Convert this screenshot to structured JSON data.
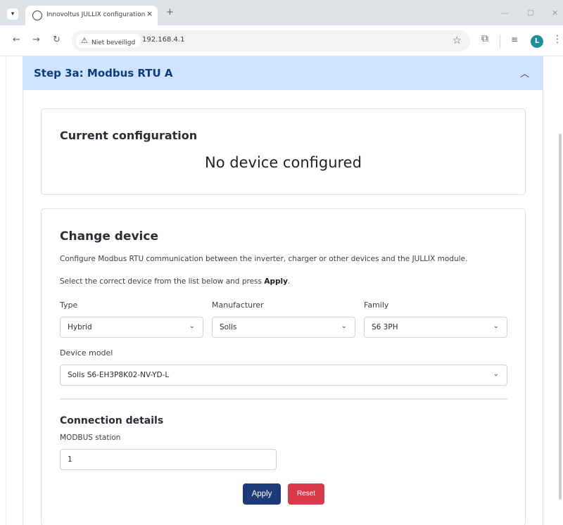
{
  "browser": {
    "tab_title": "Innovoltus JULLIX configuration",
    "tab_close": "×",
    "new_tab": "+",
    "security_label": "Niet beveiligd",
    "url": "192.168.4.1",
    "profile_initial": "L"
  },
  "icons": {
    "tab_menu": "chevron-down-icon",
    "favicon": "globe-icon",
    "back": "arrow-left-icon",
    "forward": "arrow-right-icon",
    "reload": "reload-icon",
    "warning": "warning-triangle-icon",
    "bookmark": "star-icon",
    "extensions": "puzzle-icon",
    "side_panel": "side-panel-icon",
    "menu": "kebab-menu-icon",
    "accordion": "chevron-up-icon",
    "select": "chevron-down-icon"
  },
  "accordion": {
    "title": "Step 3a: Modbus RTU A"
  },
  "current_config": {
    "heading": "Current configuration",
    "status": "No device configured"
  },
  "change_device": {
    "heading": "Change device",
    "description": "Configure Modbus RTU communication between the inverter, charger or other devices and the JULLIX module.",
    "instruction_prefix": "Select the correct device from the list below and press ",
    "instruction_bold": "Apply",
    "instruction_suffix": ".",
    "type": {
      "label": "Type",
      "value": "Hybrid"
    },
    "manufacturer": {
      "label": "Manufacturer",
      "value": "Solis"
    },
    "family": {
      "label": "Family",
      "value": "S6 3PH"
    },
    "device_model": {
      "label": "Device model",
      "value": "Solis S6-EH3P8K02-NV-YD-L"
    }
  },
  "connection": {
    "heading": "Connection details",
    "station_label": "MODBUS station",
    "station_value": "1"
  },
  "buttons": {
    "apply": "Apply",
    "reset": "Reset"
  },
  "colors": {
    "accordion_bg": "#cfe2ff",
    "accordion_text": "#0c3d7a",
    "apply": "#1d3a7a",
    "reset": "#d83a4c"
  }
}
